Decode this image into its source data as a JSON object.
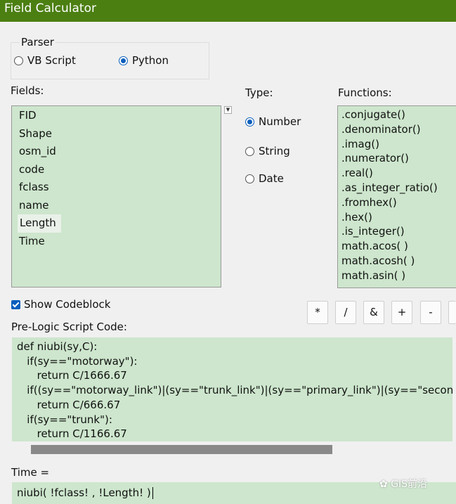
{
  "window": {
    "title": "Field Calculator"
  },
  "parser": {
    "label": "Parser",
    "options": [
      {
        "label": "VB Script",
        "selected": false
      },
      {
        "label": "Python",
        "selected": true
      }
    ]
  },
  "fields": {
    "label": "Fields:",
    "items": [
      "FID",
      "Shape",
      "osm_id",
      "code",
      "fclass",
      "name",
      "Length",
      "Time"
    ],
    "selected": "Length"
  },
  "type": {
    "label": "Type:",
    "options": [
      {
        "label": "Number",
        "selected": true
      },
      {
        "label": "String",
        "selected": false
      },
      {
        "label": "Date",
        "selected": false
      }
    ]
  },
  "functions": {
    "label": "Functions:",
    "items": [
      ".conjugate()",
      ".denominator()",
      ".imag()",
      ".numerator()",
      ".real()",
      ".as_integer_ratio()",
      ".fromhex()",
      ".hex()",
      ".is_integer()",
      "math.acos( )",
      "math.acosh( )",
      "math.asin( )"
    ]
  },
  "codeblock": {
    "show_label": "Show Codeblock",
    "checked": true
  },
  "operators": [
    "*",
    "/",
    "&",
    "+",
    "-"
  ],
  "prelogic": {
    "label": "Pre-Logic Script Code:",
    "lines": [
      "def niubi(sy,C):",
      "   if(sy==\"motorway\"):",
      "      return C/1666.67",
      "   if((sy==\"motorway_link\")|(sy==\"trunk_link\")|(sy==\"primary_link\")|(sy==\"secondary",
      "      return C/666.67",
      "   if(sy==\"trunk\"):",
      "      return C/1166.67"
    ]
  },
  "expression": {
    "label": "Time =",
    "value": "niubi( !fclass! , !Length! )"
  },
  "watermark": {
    "text": "GIS前沿"
  },
  "colors": {
    "titlebar": "#4c7f12",
    "list_bg": "#cde6cd",
    "accent": "#0a5fbd"
  }
}
